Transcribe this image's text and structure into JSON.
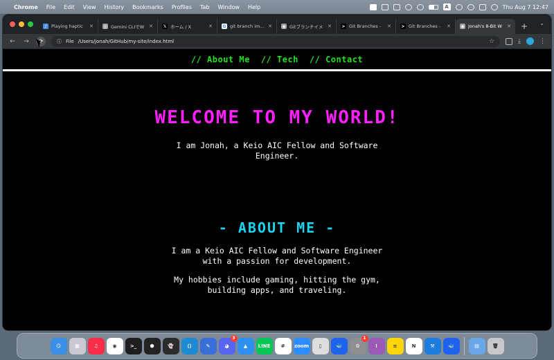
{
  "menubar": {
    "app_name": "Chrome",
    "menus": [
      "File",
      "Edit",
      "View",
      "History",
      "Bookmarks",
      "Profiles",
      "Tab",
      "Window",
      "Help"
    ],
    "clock": "Thu Aug 7  12:47",
    "input_indicator": "A"
  },
  "tabs": [
    {
      "label": "Playing haptic",
      "icon": "speaker-icon",
      "color": "#4a90e2",
      "glyph": "♪"
    },
    {
      "label": "Gemini CLIでW",
      "icon": "gemini-icon",
      "color": "#9aa0a6",
      "glyph": "◎"
    },
    {
      "label": "ホーム / X",
      "icon": "x-icon",
      "color": "#000000",
      "glyph": "𝕏"
    },
    {
      "label": "git branch imag",
      "icon": "google-icon",
      "color": "#ffffff",
      "glyph": "G"
    },
    {
      "label": "Gitブランチイメ",
      "icon": "globe-icon",
      "color": "#9aa0a6",
      "glyph": "◉"
    },
    {
      "label": "Git Branches -",
      "icon": "claude-icon",
      "color": "#000000",
      "glyph": ">"
    },
    {
      "label": "Git Branches -",
      "icon": "claude-icon",
      "color": "#000000",
      "glyph": ">"
    },
    {
      "label": "Jonah's 8-Bit W",
      "icon": "globe-icon",
      "color": "#9aa0a6",
      "glyph": "◉"
    }
  ],
  "toolbar": {
    "file_chip": "File",
    "url": "/Users/jonah/GitHub/my-site/index.html"
  },
  "site": {
    "nav": [
      "// About Me",
      "// Tech",
      "// Contact"
    ],
    "hero_title": "WELCOME TO MY WORLD!",
    "hero_subtitle": "I am Jonah, a Keio AIC Fellow and Software Engineer.",
    "about_title": "- ABOUT ME -",
    "about_p1": "I am a Keio AIC Fellow and Software Engineer with a passion for development.",
    "about_p2": "My hobbies include gaming, hitting the gym, building apps, and traveling."
  },
  "colors": {
    "nav_link": "#21e21f",
    "hero_title": "#ff1fff",
    "about_title": "#19d4f0",
    "page_bg": "#000000"
  },
  "dock": [
    {
      "name": "finder-icon",
      "color": "#3a8ee6",
      "glyph": "☺"
    },
    {
      "name": "launchpad-icon",
      "color": "#c9c9d4",
      "glyph": "▦"
    },
    {
      "name": "music-icon",
      "color": "#fa2d48",
      "glyph": "♫"
    },
    {
      "name": "chrome-icon",
      "color": "#ffffff",
      "glyph": "◉"
    },
    {
      "name": "terminal-icon",
      "color": "#1e1e1e",
      "glyph": ">_"
    },
    {
      "name": "cube-icon",
      "color": "#222222",
      "glyph": "⬢"
    },
    {
      "name": "ghost-icon",
      "color": "#2b2b2b",
      "glyph": "👻"
    },
    {
      "name": "vscode-icon",
      "color": "#1f8ad2",
      "glyph": "⟨⟩"
    },
    {
      "name": "pencil-icon",
      "color": "#3a6fd8",
      "glyph": "✎"
    },
    {
      "name": "discord-icon",
      "color": "#5865f2",
      "glyph": "◕",
      "badge": "3"
    },
    {
      "name": "keynote-icon",
      "color": "#2d8ff0",
      "glyph": "▲"
    },
    {
      "name": "line-icon",
      "color": "#06c755",
      "glyph": "LINE"
    },
    {
      "name": "slack-icon",
      "color": "#ffffff",
      "glyph": "#"
    },
    {
      "name": "zoom-icon",
      "color": "#2d8cff",
      "glyph": "zoom"
    },
    {
      "name": "phone-mirror-icon",
      "color": "#dddddd",
      "glyph": "▯"
    },
    {
      "name": "docker-icon",
      "color": "#1d63ed",
      "glyph": "🐳"
    },
    {
      "name": "settings-icon",
      "color": "#8e8e93",
      "glyph": "⚙",
      "badge": "1"
    },
    {
      "name": "feedback-icon",
      "color": "#9b59b6",
      "glyph": "!"
    },
    {
      "name": "notes-icon",
      "color": "#ffd60a",
      "glyph": "≡"
    },
    {
      "name": "notion-icon",
      "color": "#ffffff",
      "glyph": "N"
    },
    {
      "name": "xcode-icon",
      "color": "#1c7ce0",
      "glyph": "⚒"
    },
    {
      "name": "docker-icon",
      "color": "#1d63ed",
      "glyph": "🐳"
    }
  ],
  "dock_right": [
    {
      "name": "downloads-folder-icon",
      "color": "#6aa7e8",
      "glyph": "▤"
    },
    {
      "name": "trash-icon",
      "color": "#c8c8cc",
      "glyph": "🗑"
    }
  ]
}
